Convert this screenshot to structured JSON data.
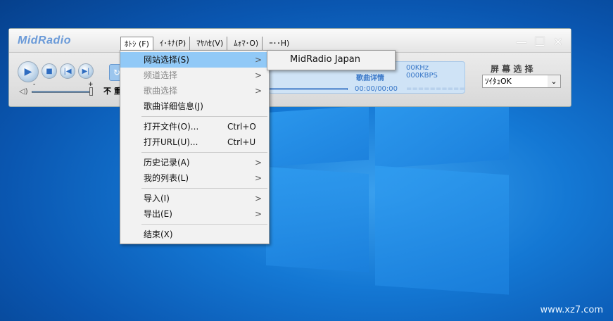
{
  "app": {
    "logo": "MidRadio"
  },
  "menubar": [
    {
      "label": "ﾎﾄｼ (F)"
    },
    {
      "label": "ｲ･ｷﾅ(P)"
    },
    {
      "label": "ﾏﾔﾊｾ(V)"
    },
    {
      "label": "ﾑｫﾏ･O)"
    },
    {
      "label": "ｰ･･H)"
    }
  ],
  "window_controls": {
    "minimize": "—",
    "maximize": "☐",
    "close": "✕"
  },
  "player": {
    "mode_label": "不 重",
    "song_detail": "歌曲详情",
    "khz": "00KHz",
    "kbps": "000KBPS",
    "time": "00:00/00:00",
    "eq": "==========",
    "vol_minus": "-",
    "vol_plus": "+",
    "volume_percent": 100,
    "progress_percent": 100
  },
  "screen_select": {
    "label": "屏 幕 选 择",
    "value": "ｿｲﾀｭOK"
  },
  "file_menu": {
    "items": [
      {
        "label": "网站选择(S)",
        "submenu": true,
        "state": "highlighted"
      },
      {
        "label": "频道选择",
        "submenu": true,
        "state": "disabled"
      },
      {
        "label": "歌曲选择",
        "submenu": true,
        "state": "disabled"
      },
      {
        "label": "歌曲详细信息(J)"
      },
      {
        "label": "打开文件(O)...",
        "shortcut": "Ctrl+O"
      },
      {
        "label": "打开URL(U)...",
        "shortcut": "Ctrl+U"
      },
      {
        "label": "历史记录(A)",
        "submenu": true
      },
      {
        "label": "我的列表(L)",
        "submenu": true
      },
      {
        "label": "导入(I)",
        "submenu": true
      },
      {
        "label": "导出(E)",
        "submenu": true
      },
      {
        "label": "结束(X)"
      }
    ]
  },
  "submenu": {
    "items": [
      {
        "label": "MidRadio Japan"
      }
    ]
  },
  "watermark": "www.xz7.com",
  "arrow": ">"
}
